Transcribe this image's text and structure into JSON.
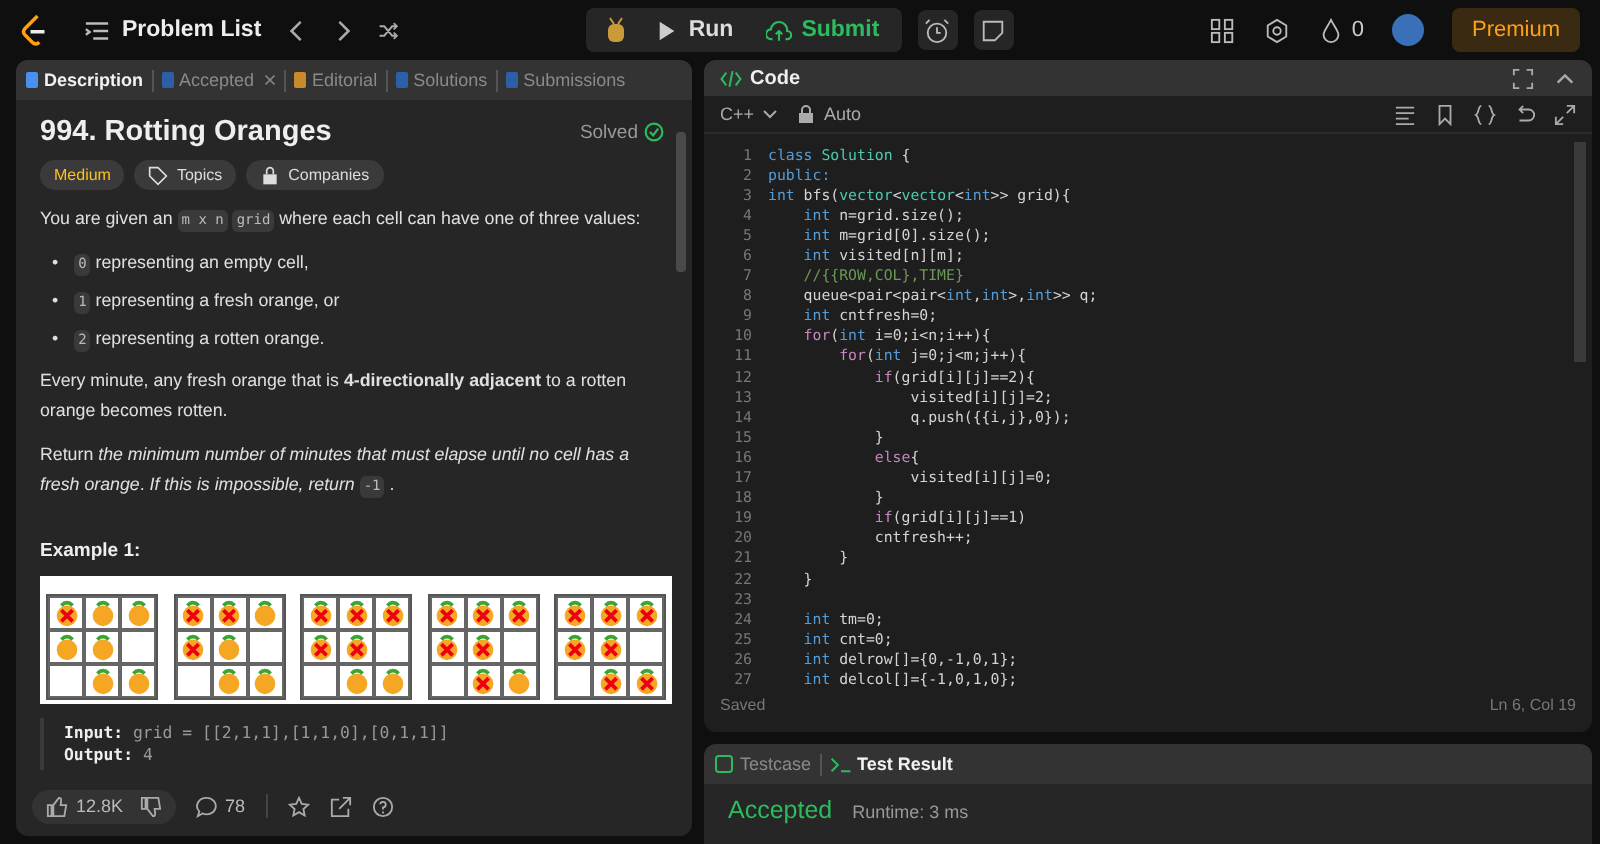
{
  "top_bar": {
    "problem_list": "Problem List",
    "run": "Run",
    "submit": "Submit",
    "streak_count": "0",
    "premium": "Premium"
  },
  "description_tabs": [
    {
      "label": "Description",
      "selected": true,
      "closable": false
    },
    {
      "label": "Accepted",
      "selected": false,
      "closable": true
    },
    {
      "label": "Editorial",
      "selected": false,
      "closable": false
    },
    {
      "label": "Solutions",
      "selected": false,
      "closable": false
    },
    {
      "label": "Submissions",
      "selected": false,
      "closable": false
    }
  ],
  "problem": {
    "title": "994. Rotting Oranges",
    "status": "Solved",
    "difficulty": "Medium",
    "tags": [
      "Topics",
      "Companies"
    ],
    "intro": [
      {
        "kind": "text",
        "text": "You are given an"
      },
      {
        "kind": "code",
        "text": "m x n"
      },
      {
        "kind": "code",
        "text": "grid"
      },
      {
        "kind": "text",
        "text": "where each cell can have one of three values:"
      }
    ],
    "bullets": [
      {
        "marker": "•",
        "segments": [
          {
            "kind": "code",
            "text": "0"
          },
          {
            "kind": "text",
            "text": "representing an empty cell,"
          }
        ]
      },
      {
        "marker": "•",
        "segments": [
          {
            "kind": "code",
            "text": "1"
          },
          {
            "kind": "text",
            "text": "representing a fresh orange, or"
          }
        ]
      },
      {
        "marker": "•",
        "segments": [
          {
            "kind": "code",
            "text": "2"
          },
          {
            "kind": "text",
            "text": "representing a rotten orange."
          }
        ]
      }
    ],
    "paragraphs": [
      [
        {
          "kind": "text",
          "text": "Every minute, any fresh orange that is **4-directionally adjacent** to a rotten orange becomes rotten."
        }
      ],
      [
        {
          "kind": "text",
          "text": "Return *the minimum number of minutes that must elapse until no cell has a fresh orange*. *If this is impossible, return*"
        },
        {
          "kind": "code",
          "text": "-1"
        },
        {
          "kind": "text",
          "text": "."
        }
      ]
    ],
    "example_title": "Example 1:",
    "example_grids": [
      {
        "cells": [
          [
            {
              "kind": "rotten"
            },
            {
              "kind": "fresh"
            },
            {
              "kind": "fresh"
            }
          ],
          [
            {
              "kind": "fresh"
            },
            {
              "kind": "fresh"
            },
            {
              "kind": "empty"
            }
          ],
          [
            {
              "kind": "empty"
            },
            {
              "kind": "fresh"
            },
            {
              "kind": "fresh"
            }
          ]
        ]
      },
      {
        "cells": [
          [
            {
              "kind": "rotten"
            },
            {
              "kind": "rotten"
            },
            {
              "kind": "fresh"
            }
          ],
          [
            {
              "kind": "rotten"
            },
            {
              "kind": "fresh"
            },
            {
              "kind": "empty"
            }
          ],
          [
            {
              "kind": "empty"
            },
            {
              "kind": "fresh"
            },
            {
              "kind": "fresh"
            }
          ]
        ]
      },
      {
        "cells": [
          [
            {
              "kind": "rotten"
            },
            {
              "kind": "rotten"
            },
            {
              "kind": "rotten"
            }
          ],
          [
            {
              "kind": "rotten"
            },
            {
              "kind": "rotten"
            },
            {
              "kind": "empty"
            }
          ],
          [
            {
              "kind": "empty"
            },
            {
              "kind": "fresh"
            },
            {
              "kind": "fresh"
            }
          ]
        ]
      },
      {
        "cells": [
          [
            {
              "kind": "rotten"
            },
            {
              "kind": "rotten"
            },
            {
              "kind": "rotten"
            }
          ],
          [
            {
              "kind": "rotten"
            },
            {
              "kind": "rotten"
            },
            {
              "kind": "empty"
            }
          ],
          [
            {
              "kind": "empty"
            },
            {
              "kind": "rotten"
            },
            {
              "kind": "fresh"
            }
          ]
        ]
      },
      {
        "cells": [
          [
            {
              "kind": "rotten"
            },
            {
              "kind": "rotten"
            },
            {
              "kind": "rotten"
            }
          ],
          [
            {
              "kind": "rotten"
            },
            {
              "kind": "rotten"
            },
            {
              "kind": "empty"
            }
          ],
          [
            {
              "kind": "empty"
            },
            {
              "kind": "rotten"
            },
            {
              "kind": "rotten"
            }
          ]
        ]
      }
    ],
    "example_lines": [
      "**Input:** grid = [[2,1,1],[1,1,0],[0,1,1]]",
      "**Output:** 4"
    ]
  },
  "footer": {
    "likes": "12.8K",
    "comments": "78"
  },
  "code_panel": {
    "title": "Code",
    "language": "C++",
    "mode": "Auto",
    "status": "Saved",
    "cursor": "Ln 6, Col 19",
    "lines": [
      {
        "number": "1",
        "tokens": [
          {
            "text": "class ",
            "kind": "type"
          },
          {
            "text": "Solution",
            "kind": "cls"
          },
          {
            "text": " {",
            "kind": "p"
          }
        ]
      },
      {
        "number": "2",
        "tokens": [
          {
            "text": "public:",
            "kind": "type"
          }
        ]
      },
      {
        "number": "3",
        "tokens": [
          {
            "text": "int",
            "kind": "type"
          },
          {
            "text": " bfs(",
            "kind": "p"
          },
          {
            "text": "vector",
            "kind": "cls"
          },
          {
            "text": "<",
            "kind": "p"
          },
          {
            "text": "vector",
            "kind": "cls"
          },
          {
            "text": "<",
            "kind": "p"
          },
          {
            "text": "int",
            "kind": "type"
          },
          {
            "text": ">> grid){",
            "kind": "p"
          }
        ]
      },
      {
        "number": "4",
        "tokens": [
          {
            "text": "    int",
            "kind": "type"
          },
          {
            "text": " n=grid.size();",
            "kind": "p"
          }
        ]
      },
      {
        "number": "5",
        "tokens": [
          {
            "text": "    int",
            "kind": "type"
          },
          {
            "text": " m=grid[0].size();",
            "kind": "p"
          }
        ]
      },
      {
        "number": "6",
        "tokens": [
          {
            "text": "    int",
            "kind": "type"
          },
          {
            "text": " visited[n][m];",
            "kind": "p"
          }
        ]
      },
      {
        "number": "7",
        "tokens": [
          {
            "text": "    //{{ROW,COL},TIME}",
            "kind": "cmt"
          }
        ]
      },
      {
        "number": "8",
        "tokens": [
          {
            "text": "    queue<pair<pair<",
            "kind": "p"
          },
          {
            "text": "int",
            "kind": "type"
          },
          {
            "text": ",",
            "kind": "p"
          },
          {
            "text": "int",
            "kind": "type"
          },
          {
            "text": ">,",
            "kind": "p"
          },
          {
            "text": "int",
            "kind": "type"
          },
          {
            "text": ">> q;",
            "kind": "p"
          }
        ]
      },
      {
        "number": "9",
        "tokens": [
          {
            "text": "    int",
            "kind": "type"
          },
          {
            "text": " cntfresh=0;",
            "kind": "p"
          }
        ]
      },
      {
        "number": "10",
        "tokens": [
          {
            "text": "    for",
            "kind": "kw"
          },
          {
            "text": "(",
            "kind": "p"
          },
          {
            "text": "int",
            "kind": "type"
          },
          {
            "text": " i=0;i<n;i++){",
            "kind": "p"
          }
        ]
      },
      {
        "number": "11",
        "tokens": [
          {
            "text": "        for",
            "kind": "kw"
          },
          {
            "text": "(",
            "kind": "p"
          },
          {
            "text": "int",
            "kind": "type"
          },
          {
            "text": " j=0;j<m;j++){",
            "kind": "p"
          }
        ]
      },
      {
        "number": "12",
        "tokens": [
          {
            "text": "            if",
            "kind": "kw"
          },
          {
            "text": "(grid[i][j]==2){",
            "kind": "p"
          }
        ]
      },
      {
        "number": "13",
        "tokens": [
          {
            "text": "                visited[i][j]=2;",
            "kind": "p"
          }
        ]
      },
      {
        "number": "14",
        "tokens": [
          {
            "text": "                q.push({{i,j},0});",
            "kind": "p"
          }
        ]
      },
      {
        "number": "15",
        "tokens": [
          {
            "text": "            }",
            "kind": "p"
          }
        ]
      },
      {
        "number": "16",
        "tokens": [
          {
            "text": "            else",
            "kind": "kw"
          },
          {
            "text": "{",
            "kind": "p"
          }
        ]
      },
      {
        "number": "17",
        "tokens": [
          {
            "text": "                visited[i][j]=0;",
            "kind": "p"
          }
        ]
      },
      {
        "number": "18",
        "tokens": [
          {
            "text": "            }",
            "kind": "p"
          }
        ]
      },
      {
        "number": "19",
        "tokens": [
          {
            "text": "            if",
            "kind": "kw"
          },
          {
            "text": "(grid[i][j]==1)",
            "kind": "p"
          }
        ]
      },
      {
        "number": "20",
        "tokens": [
          {
            "text": "            cntfresh++;",
            "kind": "p"
          }
        ]
      },
      {
        "number": "21",
        "tokens": [
          {
            "text": "        }",
            "kind": "p"
          }
        ]
      },
      {
        "number": "22",
        "tokens": [
          {
            "text": "    }",
            "kind": "p"
          }
        ]
      },
      {
        "number": "23"
      },
      {
        "number": "24",
        "tokens": [
          {
            "text": "    int",
            "kind": "type"
          },
          {
            "text": " tm=0;",
            "kind": "p"
          }
        ]
      },
      {
        "number": "25",
        "tokens": [
          {
            "text": "    int",
            "kind": "type"
          },
          {
            "text": " cnt=0;",
            "kind": "p"
          }
        ]
      },
      {
        "number": "26",
        "tokens": [
          {
            "text": "    int",
            "kind": "type"
          },
          {
            "text": " delrow[]={0,-1,0,1};",
            "kind": "p"
          }
        ]
      },
      {
        "number": "27",
        "tokens": [
          {
            "text": "    int",
            "kind": "type"
          },
          {
            "text": " delcol[]={-1,0,1,0};",
            "kind": "p"
          }
        ]
      }
    ]
  },
  "result_tabs": [
    {
      "label": "Testcase",
      "selected": false
    },
    {
      "label": "Test Result",
      "selected": true
    }
  ],
  "result": {
    "verdict": "Accepted",
    "runtime": "Runtime: 3 ms"
  }
}
